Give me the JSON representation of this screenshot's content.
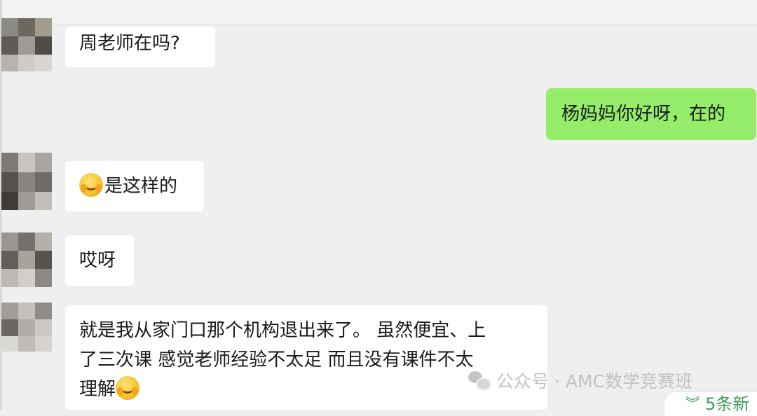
{
  "chat": {
    "messages": [
      {
        "sender": "other",
        "text": "周老师在吗?"
      },
      {
        "sender": "self",
        "text": "杨妈妈你好呀，在的"
      },
      {
        "sender": "other",
        "emoji": "facepalm-smile-emoji",
        "text": "是这样的"
      },
      {
        "sender": "other",
        "text": "哎呀"
      },
      {
        "sender": "other",
        "lines": [
          "就是我从家门口那个机构退出来了。 虽然便宜、上",
          "了三次课 感觉老师经验不太足  而且没有课件不太",
          "理解"
        ],
        "trailing_emoji": "facepalm-smile-emoji"
      }
    ]
  },
  "watermark": {
    "text": "公众号 · AMC数学竞赛班",
    "icon": "wechat-icon"
  },
  "new_messages": {
    "icon": "double-chevron-down-icon",
    "label": "5条新"
  },
  "colors": {
    "background": "#efefef",
    "incoming_bubble": "#ffffff",
    "outgoing_bubble": "#95ec69",
    "new_messages_text": "#3f9a57",
    "watermark_text": "#c2c2c2"
  }
}
